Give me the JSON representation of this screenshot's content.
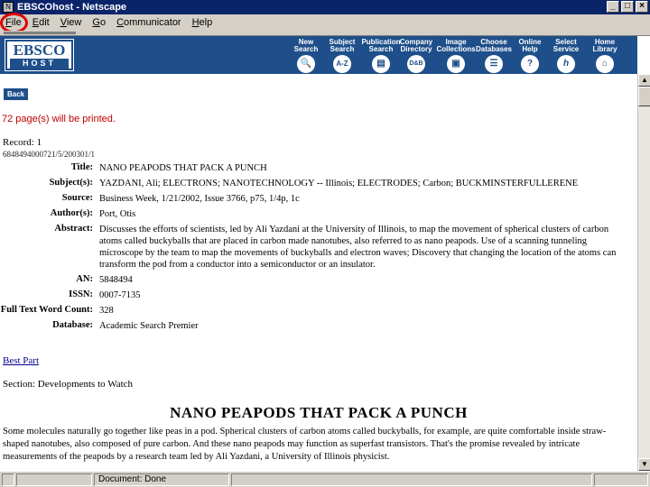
{
  "window": {
    "title": "EBSCOhost - Netscape",
    "buttons": [
      "_",
      "□",
      "×"
    ]
  },
  "menu": [
    {
      "label": "File",
      "underline": "F",
      "rest": "ile"
    },
    {
      "label": "Edit",
      "underline": "E",
      "rest": "dit"
    },
    {
      "label": "View",
      "underline": "V",
      "rest": "iew"
    },
    {
      "label": "Go",
      "underline": "G",
      "rest": "o"
    },
    {
      "label": "Communicator",
      "underline": "C",
      "rest": "ommunicator"
    },
    {
      "label": "Help",
      "underline": "H",
      "rest": "elp"
    }
  ],
  "header": {
    "logo_top": "EBSCO",
    "logo_bottom": "HOST",
    "nav": [
      {
        "line1": "New",
        "line2": "Search",
        "glyph": "🔍",
        "icon": "magnifier-icon"
      },
      {
        "line1": "Subject",
        "line2": "Search",
        "glyph": "A-Z",
        "icon": "az-icon"
      },
      {
        "line1": "Publication",
        "line2": "Search",
        "glyph": "▤",
        "icon": "publication-icon"
      },
      {
        "line1": "Company",
        "line2": "Directory",
        "glyph": "D&B",
        "icon": "dnb-icon"
      },
      {
        "line1": "Image",
        "line2": "Collections",
        "glyph": "▣",
        "icon": "image-icon"
      },
      {
        "line1": "Choose",
        "line2": "Databases",
        "glyph": "☰",
        "icon": "database-icon"
      },
      {
        "line1": "Online",
        "line2": "Help",
        "glyph": "?",
        "icon": "help-icon"
      },
      {
        "line1": "Select",
        "line2": "Service",
        "glyph": "h",
        "icon": "service-icon"
      },
      {
        "line1": "Home",
        "line2": "Library",
        "glyph": "⌂",
        "icon": "library-icon"
      }
    ]
  },
  "content": {
    "back_label": "Back",
    "print_message": "72 page(s) will be printed.",
    "record_label": "Record: 1",
    "record_id": "6848494000721/5/200301/1",
    "fields": [
      {
        "label": "Title:",
        "value": "NANO PEAPODS THAT PACK A PUNCH"
      },
      {
        "label": "Subject(s):",
        "value": "YAZDANI, Ali; ELECTRONS; NANOTECHNOLOGY -- Illinois; ELECTRODES; Carbon; BUCKMINSTERFULLERENE"
      },
      {
        "label": "Source:",
        "value": "Business Week, 1/21/2002, Issue 3766, p75, 1/4p, 1c"
      },
      {
        "label": "Author(s):",
        "value": "Port, Otis"
      },
      {
        "label": "Abstract:",
        "value": "Discusses the efforts of scientists, led by Ali Yazdani at the University of Illinois, to map the movement of spherical clusters of carbon atoms called buckyballs that are placed in carbon made nanotubes, also referred to as nano peapods. Use of a scanning tunneling microscope by the team to map the movements of buckyballs and electron waves; Discovery that changing the location of the atoms can transform the pod from a conductor into a semiconductor or an insulator."
      },
      {
        "label": "AN:",
        "value": "5848494"
      },
      {
        "label": "ISSN:",
        "value": "0007-7135"
      },
      {
        "label": "Full Text Word Count:",
        "value": "328"
      },
      {
        "label": "Database:",
        "value": "Academic Search Premier"
      }
    ],
    "best_part": "Best Part",
    "section": "Section: Developments to Watch",
    "article_title": "NANO PEAPODS THAT PACK A PUNCH",
    "article_body": "Some molecules naturally go together like peas in a pod. Spherical clusters of carbon atoms called buckyballs, for example, are quite comfortable inside straw-shaped nanotubes, also composed of pure carbon. And these nano peapods may function as superfast transistors. That's the promise revealed by intricate measurements of the peapods by a research team led by Ali Yazdani, a University of Illinois physicist."
  },
  "status": {
    "text": "Document: Done"
  },
  "colors": {
    "header_blue": "#1e4f8a",
    "title_bar": "#0a246a",
    "print_red": "#c00000",
    "highlight_circle": "#e00000"
  }
}
